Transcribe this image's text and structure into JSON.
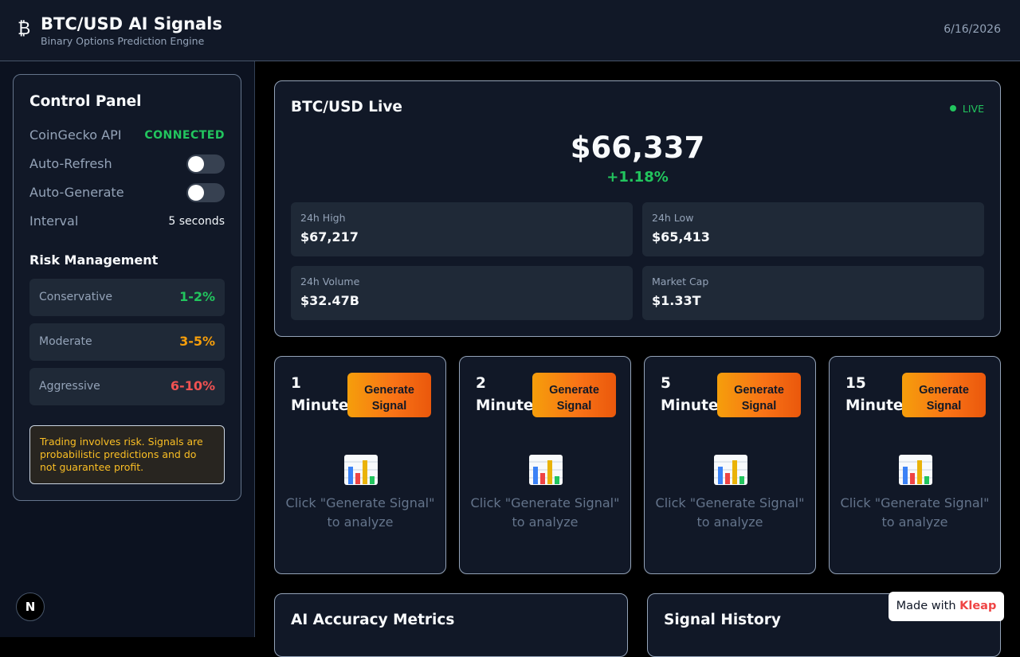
{
  "header": {
    "logo_glyph": "₿",
    "title": "BTC/USD AI Signals",
    "subtitle": "Binary Options Prediction Engine",
    "date": "6/16/2026"
  },
  "control_panel": {
    "title": "Control Panel",
    "api_label": "CoinGecko API",
    "api_status": "CONNECTED",
    "auto_refresh_label": "Auto-Refresh",
    "auto_refresh_on": false,
    "auto_generate_label": "Auto-Generate",
    "auto_generate_on": false,
    "interval_label": "Interval",
    "interval_value": "5 seconds",
    "risk": {
      "title": "Risk Management",
      "items": [
        {
          "label": "Conservative",
          "value": "1-2%",
          "color": "#22c55e"
        },
        {
          "label": "Moderate",
          "value": "3-5%",
          "color": "#f59e0b"
        },
        {
          "label": "Aggressive",
          "value": "6-10%",
          "color": "#f05252"
        }
      ]
    },
    "warning": "Trading involves risk. Signals are probabilistic predictions and do not guarantee profit."
  },
  "live": {
    "title": "BTC/USD Live",
    "live_label": "LIVE",
    "price": "$66,337",
    "change": "+1.18%",
    "stats": [
      {
        "label": "24h High",
        "value": "$67,217"
      },
      {
        "label": "24h Low",
        "value": "$65,413"
      },
      {
        "label": "24h Volume",
        "value": "$32.47B"
      },
      {
        "label": "Market Cap",
        "value": "$1.33T"
      }
    ]
  },
  "signals": [
    {
      "title": "1 Minute",
      "button": "Generate Signal",
      "hint": "Click \"Generate Signal\" to analyze",
      "icon": "bar-chart-icon"
    },
    {
      "title": "2 Minutes",
      "button": "Generate Signal",
      "hint": "Click \"Generate Signal\" to analyze",
      "icon": "bar-chart-icon"
    },
    {
      "title": "5 Minutes",
      "button": "Generate Signal",
      "hint": "Click \"Generate Signal\" to analyze",
      "icon": "bar-chart-icon"
    },
    {
      "title": "15 Minutes",
      "button": "Generate Signal",
      "hint": "Click \"Generate Signal\" to analyze",
      "icon": "bar-chart-icon"
    }
  ],
  "accuracy": {
    "title": "AI Accuracy Metrics"
  },
  "history": {
    "title": "Signal History"
  },
  "next_badge": "N",
  "kleap": {
    "prefix": "Made with ",
    "brand": "Kleap"
  },
  "colors": {
    "accent_orange": "#f97316",
    "success": "#22c55e",
    "warning": "#f59e0b",
    "danger": "#f05252"
  }
}
